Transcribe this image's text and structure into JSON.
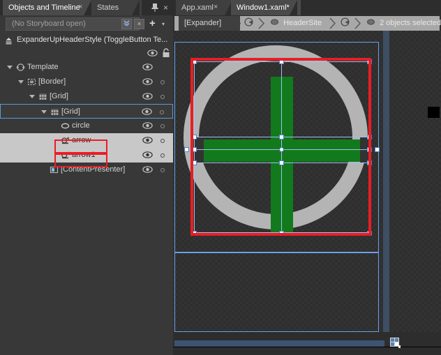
{
  "panel": {
    "tabs": [
      {
        "label": "Objects and Timeline",
        "closable": true,
        "active": true
      },
      {
        "label": "States",
        "closable": false,
        "active": false
      }
    ],
    "close_glyph": "×",
    "pin_glyph": "⚐",
    "storyboard": {
      "value": "(No Storyboard open)",
      "placeholder": "(No Storyboard open)",
      "chevrons_label": "»",
      "close_label": "×",
      "plus_label": "+",
      "caret_label": "▾"
    },
    "style_name": "ExpanderUpHeaderStyle (ToggleButton Te...",
    "style_icon": "breadcrumb-up-icon",
    "eye_icon": "eye-icon",
    "lock_icon": "lock-icon",
    "tree": [
      {
        "label": "Template",
        "depth": 0,
        "icon": "template-icon",
        "expander": "open",
        "state": "normal",
        "eye": true,
        "dot": false
      },
      {
        "label": "[Border]",
        "depth": 1,
        "icon": "border-icon",
        "expander": "open",
        "state": "normal",
        "eye": true,
        "dot": true
      },
      {
        "label": "[Grid]",
        "depth": 2,
        "icon": "grid-icon",
        "expander": "open",
        "state": "normal",
        "eye": true,
        "dot": true
      },
      {
        "label": "[Grid]",
        "depth": 3,
        "icon": "grid-icon",
        "expander": "open",
        "state": "selected",
        "eye": true,
        "dot": true
      },
      {
        "label": "circle",
        "depth": 4,
        "icon": "ellipse-icon",
        "expander": "none",
        "state": "normal",
        "eye": true,
        "dot": true
      },
      {
        "label": "arrow",
        "depth": 4,
        "icon": "path-icon",
        "expander": "none",
        "state": "highlight",
        "eye": true,
        "dot": true
      },
      {
        "label": "arrow1",
        "depth": 4,
        "icon": "path-icon",
        "expander": "none",
        "state": "highlight",
        "eye": true,
        "dot": true
      },
      {
        "label": "[ContentPresenter]",
        "depth": 3,
        "icon": "contentpresenter-icon",
        "expander": "none",
        "state": "normal",
        "eye": true,
        "dot": true
      }
    ]
  },
  "document": {
    "tabs": [
      {
        "label": "App.xaml",
        "closable": true,
        "active": false
      },
      {
        "label": "Window1.xaml*",
        "closable": false,
        "active": true
      }
    ],
    "close_glyph": "×",
    "breadcrumb": [
      {
        "label": "[Expander]",
        "icon": "none",
        "style": "dark"
      },
      {
        "label": "",
        "icon": "template-icon",
        "style": "lite"
      },
      {
        "label": "HeaderSite",
        "icon": "element-icon",
        "style": "lite"
      },
      {
        "label": "",
        "icon": "template-icon",
        "style": "lite"
      },
      {
        "label": "2 objects selected",
        "icon": "element-icon",
        "style": "lite"
      }
    ]
  },
  "colors": {
    "accent_red": "#ea1d24",
    "selection_blue": "#6d9eeb",
    "handle_blue": "#9cc2f0",
    "arrow_green": "#127a1c",
    "ring_gray": "#b4b4b4",
    "canvas_bg": "#2e2e2e",
    "panel_bg": "#383838",
    "highlight_row": "#c8c8c8"
  },
  "canvas": {
    "artboard_label": "design-surface",
    "shapes": [
      {
        "name": "circle",
        "type": "ring",
        "color": "#b4b4b4"
      },
      {
        "name": "arrow",
        "type": "vertical-bar",
        "color": "#127a1c"
      },
      {
        "name": "arrow1",
        "type": "horizontal-bar",
        "color": "#127a1c"
      }
    ]
  }
}
